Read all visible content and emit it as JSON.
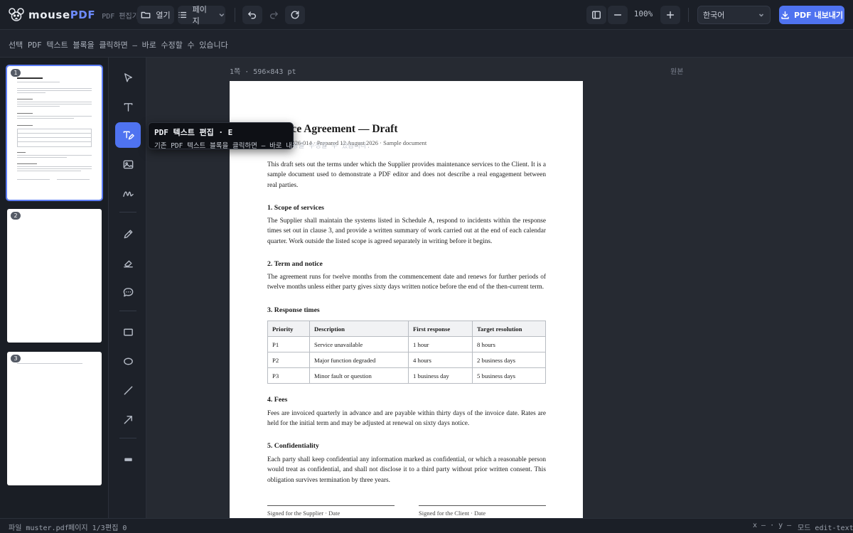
{
  "app": {
    "brand_prefix": "mouse",
    "brand_suffix": "PDF",
    "subtitle": "PDF 편집기"
  },
  "toolbar": {
    "open_label": "열기",
    "pages_label": "페이지",
    "zoom_value": "100%",
    "select_value": "한국어",
    "download_label": "PDF 내보내기"
  },
  "hint": "선택 PDF 텍스트 블록을 클릭하면 — 바로 수정할 수 있습니다",
  "thumbnails": [
    {
      "num": "1",
      "active": true
    },
    {
      "num": "2",
      "active": false
    },
    {
      "num": "3",
      "active": false
    }
  ],
  "tooltip": {
    "title": "PDF 텍스트 편집 · E",
    "description": "기존 PDF 텍스트 블록을 클릭하면 — 바로 내용을 수정할 수 있습니다."
  },
  "workspace": {
    "page_info": "1쪽 · 596×843 pt",
    "page_mark": "원본"
  },
  "document": {
    "title": "Service Agreement — Draft",
    "meta": "Ref. SA-2026-014 · Prepared 12 August 2026 · Sample document",
    "intro": "This draft sets out the terms under which the Supplier provides maintenance services to the Client. It is a sample document used to demonstrate a PDF editor and does not describe a real engagement between real parties.",
    "s1_title": "1. Scope of services",
    "s1_body": "The Supplier shall maintain the systems listed in Schedule A, respond to incidents within the response times set out in clause 3, and provide a written summary of work carried out at the end of each calendar quarter. Work outside the listed scope is agreed separately in writing before it begins.",
    "s2_title": "2. Term and notice",
    "s2_body": "The agreement runs for twelve months from the commencement date and renews for further periods of twelve months unless either party gives sixty days written notice before the end of the then-current term.",
    "s3_title": "3. Response times",
    "table": {
      "headers": [
        "Priority",
        "Description",
        "First response",
        "Target resolution"
      ],
      "rows": [
        [
          "P1",
          "Service unavailable",
          "1 hour",
          "8 hours"
        ],
        [
          "P2",
          "Major function degraded",
          "4 hours",
          "2 business days"
        ],
        [
          "P3",
          "Minor fault or question",
          "1 business day",
          "5 business days"
        ]
      ]
    },
    "s4_title": "4. Fees",
    "s4_body": "Fees are invoiced quarterly in advance and are payable within thirty days of the invoice date. Rates are held for the initial term and may be adjusted at renewal on sixty days notice.",
    "s5_title": "5. Confidentiality",
    "s5_body": "Each party shall keep confidential any information marked as confidential, or which a reasonable person would treat as confidential, and shall not disclose it to a third party without prior written consent. This obligation survives termination by three years.",
    "sig_supplier": "Signed for the Supplier · Date",
    "sig_client": "Signed for the Client · Date"
  },
  "status": {
    "file": "파일 muster.pdf",
    "pages": "페이지 1/3",
    "edits": "편집 0",
    "coords": "x — · y —",
    "mode": "모드 edit-text"
  }
}
